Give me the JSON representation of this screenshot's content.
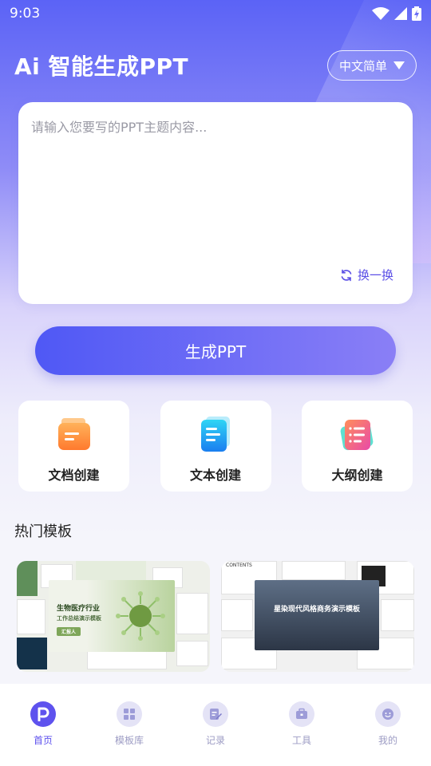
{
  "status_bar": {
    "time": "9:03"
  },
  "header": {
    "title": "Ai 智能生成PPT",
    "language": "中文简单"
  },
  "input": {
    "placeholder": "请输入您要写的PPT主题内容...",
    "value": "",
    "refresh_label": "换一换"
  },
  "generate_button": "生成PPT",
  "create_options": [
    {
      "label": "文档创建",
      "icon": "document-folder-icon",
      "color": "#ff8a3c"
    },
    {
      "label": "文本创建",
      "icon": "text-doc-icon",
      "color": "#1ec3f0"
    },
    {
      "label": "大纲创建",
      "icon": "outline-doc-icon",
      "color": "#f25ea9"
    }
  ],
  "section_title": "热门模板",
  "templates": [
    {
      "title": "生物医疗行业",
      "subtitle": "工作总结演示模板",
      "button": "汇报人",
      "accent": "#8fbf6a"
    },
    {
      "title": "星染现代风格商务演示模板",
      "header": "CONTENTS",
      "accent": "#3a4658"
    }
  ],
  "bottom_nav": [
    {
      "label": "首页",
      "icon": "home-p-icon",
      "active": true
    },
    {
      "label": "模板库",
      "icon": "grid-icon",
      "active": false
    },
    {
      "label": "记录",
      "icon": "record-edit-icon",
      "active": false
    },
    {
      "label": "工具",
      "icon": "toolbox-icon",
      "active": false
    },
    {
      "label": "我的",
      "icon": "profile-face-icon",
      "active": false
    }
  ],
  "colors": {
    "brand": "#5b52ee",
    "gradient_start": "#4f58f5",
    "gradient_end": "#8a7ff6"
  }
}
